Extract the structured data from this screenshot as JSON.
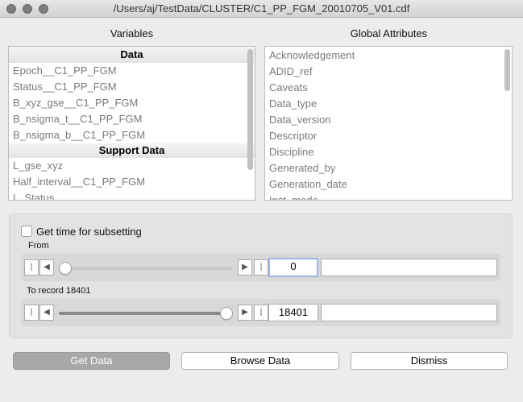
{
  "window": {
    "title": "/Users/aj/TestData/CLUSTER/C1_PP_FGM_20010705_V01.cdf"
  },
  "variables": {
    "header": "Variables",
    "group_data": "Data",
    "data_items": [
      "Epoch__C1_PP_FGM",
      "Status__C1_PP_FGM",
      "B_xyz_gse__C1_PP_FGM",
      "B_nsigma_t__C1_PP_FGM",
      "B_nsigma_b__C1_PP_FGM"
    ],
    "group_support": "Support Data",
    "support_items": [
      "L_gse_xyz",
      "Half_interval__C1_PP_FGM",
      "L_Status"
    ]
  },
  "global_attributes": {
    "header": "Global Attributes",
    "items": [
      "Acknowledgement",
      "ADID_ref",
      "Caveats",
      "Data_type",
      "Data_version",
      "Descriptor",
      "Discipline",
      "Generated_by",
      "Generation_date",
      "Inst_mode"
    ]
  },
  "subset": {
    "checkbox_label": "Get time for subsetting",
    "from_label": "From",
    "to_label": "To   record 18401",
    "from_value": "0",
    "to_value": "18401",
    "from_position": 0.0,
    "to_position": 1.0
  },
  "buttons": {
    "get_data": "Get Data",
    "browse_data": "Browse Data",
    "dismiss": "Dismiss"
  },
  "icons": {
    "first": "|",
    "prev": "◀",
    "next": "▶",
    "last": "|"
  },
  "colors": {
    "slider_fill": "#2f7de1",
    "track": "#c8c8c8"
  }
}
